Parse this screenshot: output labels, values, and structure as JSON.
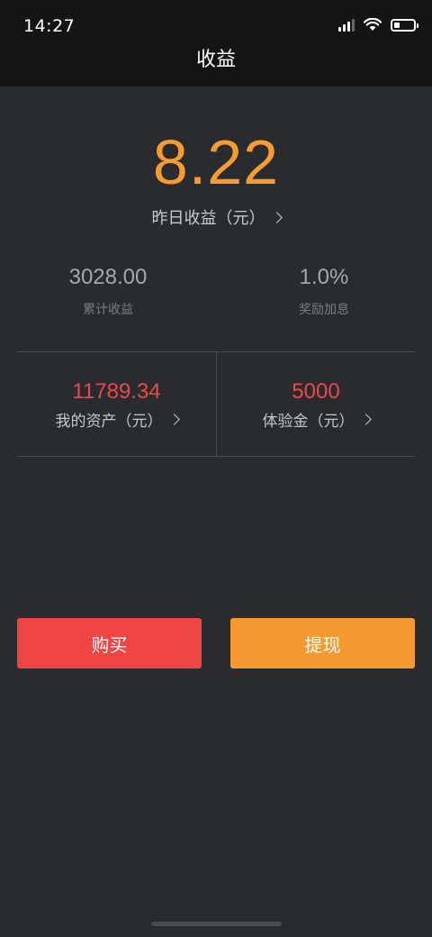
{
  "status_bar": {
    "time": "14:27",
    "icons": [
      "signal-icon",
      "wifi-icon",
      "battery-icon"
    ],
    "battery_level": 0.3
  },
  "nav": {
    "title": "收益"
  },
  "hero": {
    "amount": "8.22",
    "label": "昨日收益（元）"
  },
  "stats": [
    {
      "value": "3028.00",
      "label": "累计收益"
    },
    {
      "value": "1.0%",
      "label": "奖励加息"
    }
  ],
  "assets": [
    {
      "value": "11789.34",
      "label": "我的资产（元）"
    },
    {
      "value": "5000",
      "label": "体验金（元）"
    }
  ],
  "actions": {
    "buy_label": "购买",
    "withdraw_label": "提现"
  },
  "colors": {
    "background": "#2a2b2f",
    "header": "#141414",
    "accent_orange": "#f49c33",
    "accent_red": "#e84a4a",
    "buy_button": "#ef4444",
    "withdraw_button": "#f59a33"
  }
}
